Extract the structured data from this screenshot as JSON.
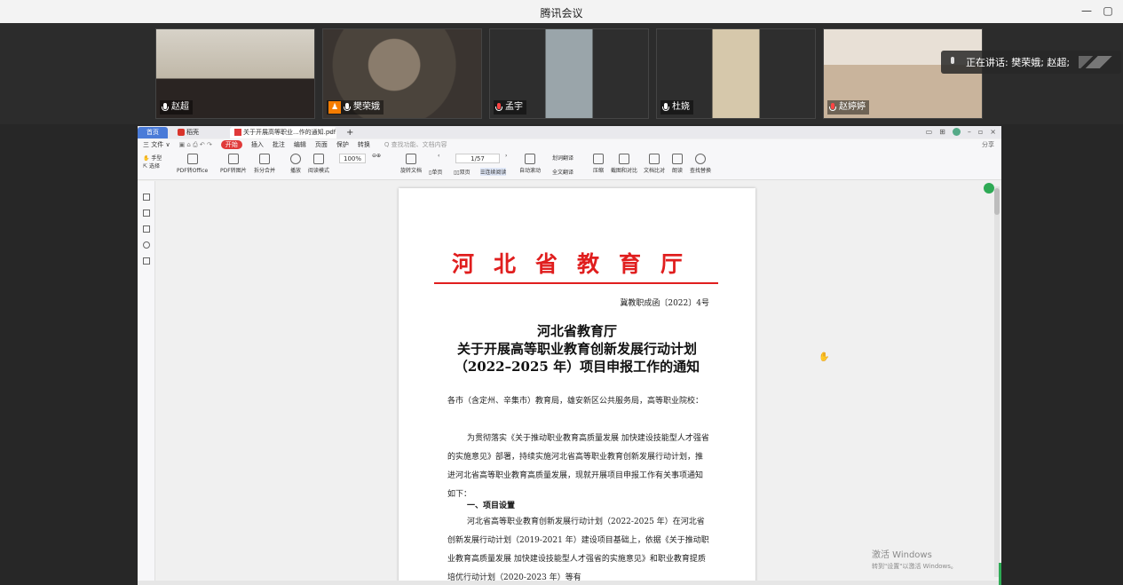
{
  "window": {
    "title": "腾讯会议",
    "minimize": "—",
    "restore": "▢"
  },
  "participants": [
    {
      "name": "赵超",
      "host": false,
      "muted": false,
      "feed_color": "#c9c2b6"
    },
    {
      "name": "樊荣娥",
      "host": true,
      "muted": false,
      "feed_color": "#5e564c"
    },
    {
      "name": "孟宇",
      "host": false,
      "muted": true,
      "feed_color": "#7a8a90"
    },
    {
      "name": "杜娆",
      "host": false,
      "muted": false,
      "feed_color": "#c8b99c"
    },
    {
      "name": "赵婷婷",
      "host": false,
      "muted": true,
      "feed_color": "#d9c9b7"
    }
  ],
  "speaking": {
    "label": "正在讲话: 樊荣娥; 赵超;"
  },
  "wps": {
    "tabs": {
      "home": "首页",
      "t1": "稻壳",
      "t2": "关于开展高等职业...作的通知.pdf",
      "plus": "+"
    },
    "menus": [
      "三 文件 ∨",
      "开始",
      "插入",
      "批注",
      "编辑",
      "页面",
      "保护",
      "转换"
    ],
    "search_placeholder": "Q 查找功能、文档内容",
    "menu_right": "分享",
    "ribbon": {
      "hand": "手型",
      "select": "选择",
      "pdf_to_office": "PDF转Office",
      "pdf_to_image": "PDF转图片",
      "split_merge": "拆分合并",
      "play": "播放",
      "read_mode": "阅读模式",
      "zoom": "100%",
      "rotate": "旋转文档",
      "page_num": "1/57",
      "single": "单页",
      "double": "双页",
      "continuous": "连续阅读",
      "auto_scroll": "自动滚动",
      "translate": "划词翻译",
      "full_translate": "全文翻译",
      "compress": "压缩",
      "screenshot": "截图和对比",
      "compare": "文档比对",
      "read_aloud": "朗读",
      "find_replace": "查找替换"
    }
  },
  "doc": {
    "header": "河北省教育厅",
    "doc_no": "冀教职成函〔2022〕4号",
    "title_lines": [
      "河北省教育厅",
      "关于开展高等职业教育创新发展行动计划",
      "（2022–2025 年）项目申报工作的通知"
    ],
    "paragraphs": [
      "各市（含定州、辛集市）教育局，雄安新区公共服务局，高等职业院校：",
      "为贯彻落实《关于推动职业教育高质量发展 加快建设技能型人才强省的实施意见》部署，持续实施河北省高等职业教育创新发展行动计划，推进河北省高等职业教育高质量发展，现就开展项目申报工作有关事项通知如下：",
      "河北省高等职业教育创新发展行动计划（2022-2025 年）在河北省创新发展行动计划（2019-2021 年）建设项目基础上，依据《关于推动职业教育高质量发展 加快建设技能型人才强省的实施意见》和职业教育提质培优行动计划（2020-2023 年）等有"
    ],
    "section1": "一、项目设置"
  },
  "watermark": {
    "line1": "激活 Windows",
    "line2": "转到\"设置\"以激活 Windows。"
  }
}
